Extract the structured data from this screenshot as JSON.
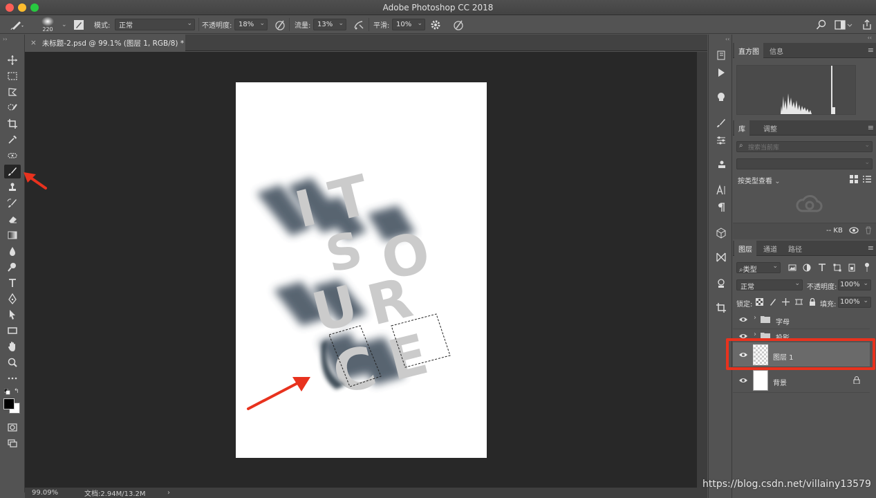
{
  "window": {
    "title": "Adobe Photoshop CC 2018"
  },
  "options_bar": {
    "brush_size": "220",
    "mode_label": "模式:",
    "mode_value": "正常",
    "opacity_label": "不透明度:",
    "opacity_value": "18%",
    "flow_label": "流量:",
    "flow_value": "13%",
    "smoothing_label": "平滑:",
    "smoothing_value": "10%"
  },
  "document_tab": {
    "title": "未标题-2.psd @ 99.1% (图层 1, RGB/8) *"
  },
  "status": {
    "zoom": "99.09%",
    "doc_info": "文档:2.94M/13.2M"
  },
  "artwork": {
    "letters": [
      "I",
      "T",
      "S",
      "O",
      "U",
      "R",
      "C",
      "E"
    ]
  },
  "histogram_panel": {
    "tabs": [
      "直方图",
      "信息"
    ]
  },
  "library_panel": {
    "tabs": [
      "库",
      "调整"
    ],
    "search_placeholder": "搜索当前库",
    "view_by": "按类型查看",
    "size": "-- KB"
  },
  "layers_panel": {
    "tabs": [
      "图层",
      "通道",
      "路径"
    ],
    "filter_label": "类型",
    "blend_mode": "正常",
    "opacity_label": "不透明度:",
    "opacity_value": "100%",
    "lock_label": "锁定:",
    "fill_label": "填充:",
    "fill_value": "100%",
    "layers": [
      {
        "name": "字母",
        "type": "group"
      },
      {
        "name": "投影",
        "type": "group"
      },
      {
        "name": "图层 1",
        "type": "layer",
        "selected": true
      },
      {
        "name": "背景",
        "type": "background",
        "locked": true
      }
    ]
  },
  "watermark": "https://blog.csdn.net/villainy13579",
  "colors": {
    "annotation_red": "#e8321e",
    "ui_panel": "#535353",
    "canvas_bg": "#282828"
  }
}
